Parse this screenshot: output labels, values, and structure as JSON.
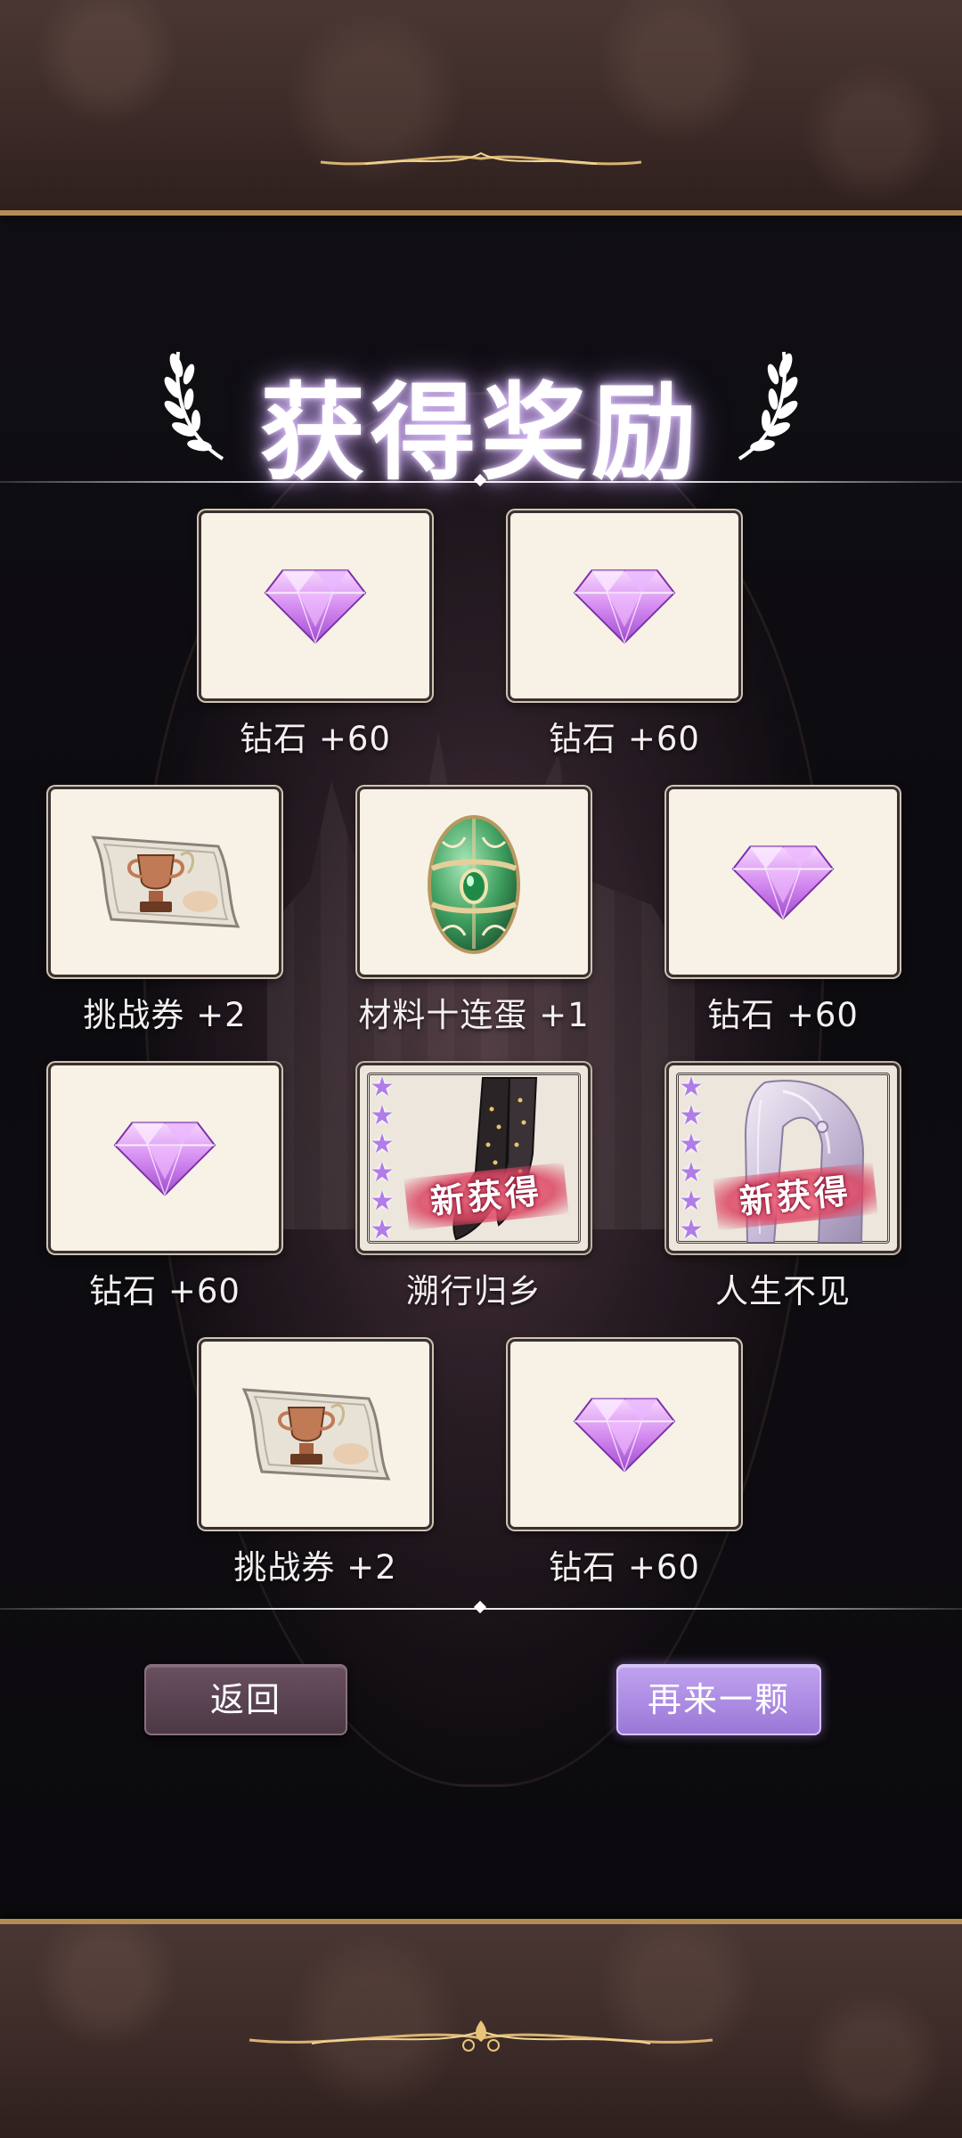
{
  "title": "获得奖励",
  "rewards": [
    {
      "label": "钻石 +60",
      "icon": "diamond-icon"
    },
    {
      "label": "钻石 +60",
      "icon": "diamond-icon"
    },
    {
      "label": "挑战券 +2",
      "icon": "challenge-ticket-icon"
    },
    {
      "label": "材料十连蛋 +1",
      "icon": "green-egg-icon"
    },
    {
      "label": "钻石 +60",
      "icon": "diamond-icon"
    },
    {
      "label": "钻石 +60",
      "icon": "diamond-icon"
    },
    {
      "label": "溯行归乡",
      "icon": "shoes-item-icon",
      "badge": "新获得",
      "stars": 6
    },
    {
      "label": "人生不见",
      "icon": "hair-item-icon",
      "badge": "新获得",
      "stars": 6
    },
    {
      "label": "挑战券 +2",
      "icon": "challenge-ticket-icon"
    },
    {
      "label": "钻石 +60",
      "icon": "diamond-icon"
    }
  ],
  "buttons": {
    "back": "返回",
    "again": "再来一颗"
  },
  "colors": {
    "diamond": "#d58cf0",
    "accent_button": "#b08ee6",
    "card_bg": "#f7f1e6",
    "band": "#3b2a27",
    "gold_trim": "#b48a55"
  }
}
